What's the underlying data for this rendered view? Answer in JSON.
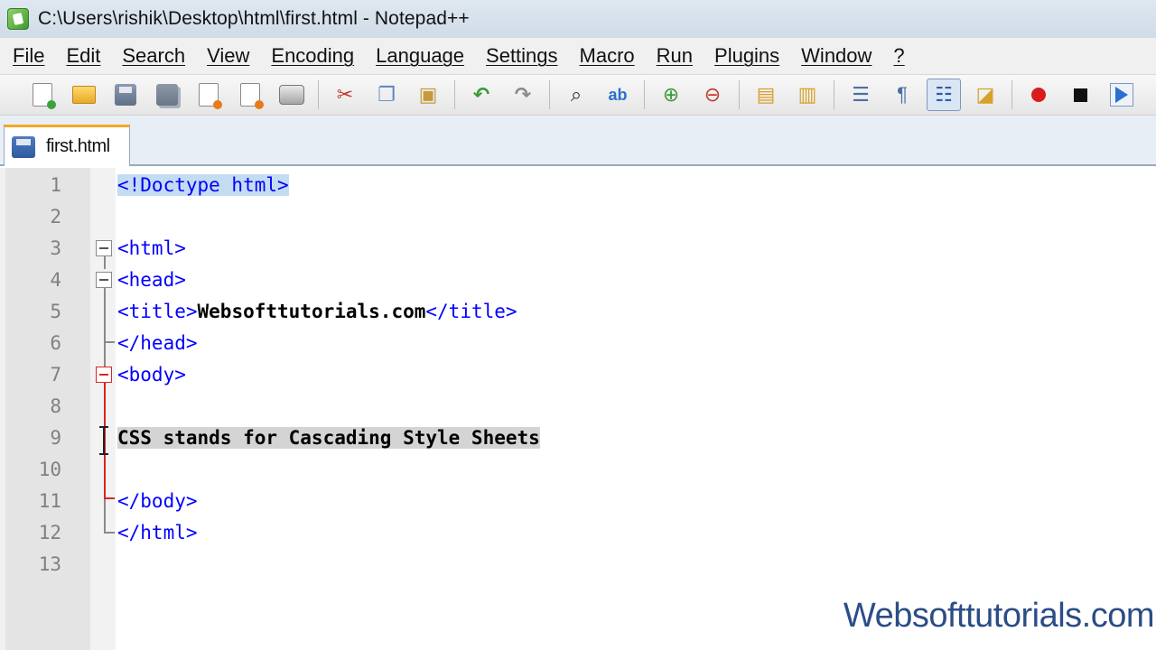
{
  "window": {
    "title": "C:\\Users\\rishik\\Desktop\\html\\first.html - Notepad++"
  },
  "menu": {
    "items": [
      "File",
      "Edit",
      "Search",
      "View",
      "Encoding",
      "Language",
      "Settings",
      "Macro",
      "Run",
      "Plugins",
      "Window",
      "?"
    ]
  },
  "toolbar": {
    "icons": [
      "new-file-icon",
      "open-file-icon",
      "save-icon",
      "save-all-icon",
      "close-icon",
      "close-all-icon",
      "print-icon",
      "cut-icon",
      "copy-icon",
      "paste-icon",
      "undo-icon",
      "redo-icon",
      "find-icon",
      "replace-icon",
      "zoom-in-icon",
      "zoom-out-icon",
      "sync-vertical-icon",
      "sync-horizontal-icon",
      "word-wrap-icon",
      "show-all-chars-icon",
      "indent-guide-icon",
      "user-language-icon",
      "record-macro-icon",
      "stop-record-icon",
      "play-macro-icon"
    ],
    "active": "indent-guide-icon"
  },
  "tabs": [
    {
      "label": "first.html",
      "active": true
    }
  ],
  "editor": {
    "line_numbers": [
      "1",
      "2",
      "3",
      "4",
      "5",
      "6",
      "7",
      "8",
      "9",
      "10",
      "11",
      "12",
      "13"
    ],
    "lines": {
      "l1": "<!Doctype html>",
      "l3": "<html>",
      "l4": "<head>",
      "l5_open": "<title>",
      "l5_text": "Websofttutorials.com",
      "l5_close": "</title>",
      "l6": "</head>",
      "l7": "<body>",
      "l9": "CSS stands for Cascading Style Sheets",
      "l11": "</body>",
      "l12": "</html>"
    },
    "colors": {
      "tag": "#0000ff",
      "text": "#000000",
      "selection": "#d4d4d4",
      "fold_active": "#dd2222"
    }
  },
  "watermark": "Websofttutorials.com"
}
